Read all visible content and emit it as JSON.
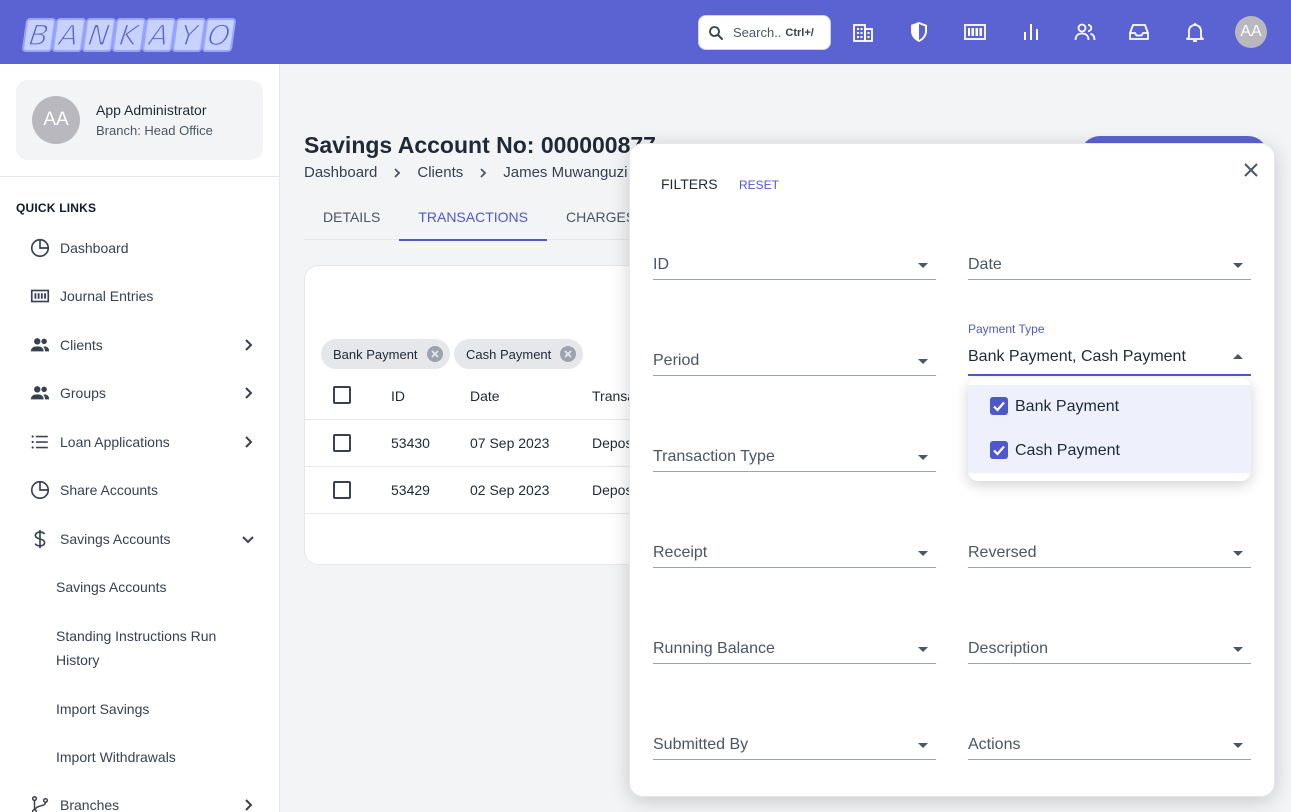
{
  "brand": {
    "logo_letters": [
      "B",
      "A",
      "N",
      "K",
      "A",
      "Y",
      "O"
    ],
    "accent": "#5b63d3"
  },
  "topbar": {
    "search_placeholder": "Search..",
    "search_shortcut": "Ctrl+/",
    "avatar_initials": "AA",
    "icons": [
      "building-icon",
      "shield-icon",
      "ledger-icon",
      "bar-chart-icon",
      "users-icon",
      "inbox-icon",
      "bell-icon"
    ]
  },
  "user": {
    "initials": "AA",
    "name": "App Administrator",
    "branch": "Branch: Head Office"
  },
  "sidebar": {
    "quick_links_title": "QUICK LINKS",
    "items": [
      {
        "label": "Dashboard"
      },
      {
        "label": "Journal Entries"
      },
      {
        "label": "Clients"
      },
      {
        "label": "Groups"
      },
      {
        "label": "Loan Applications"
      },
      {
        "label": "Share Accounts"
      },
      {
        "label": "Savings Accounts"
      },
      {
        "label": "Branches"
      }
    ],
    "sub_items": [
      {
        "label": "Savings Accounts"
      },
      {
        "label": "Standing Instructions Run History"
      },
      {
        "label": "Import Savings"
      },
      {
        "label": "Import Withdrawals"
      }
    ]
  },
  "page": {
    "title": "Savings Account No: 000000877",
    "breadcrumbs": [
      "Dashboard",
      "Clients",
      "James Muwanguzi"
    ],
    "tabs": [
      "DETAILS",
      "TRANSACTIONS",
      "CHARGES"
    ]
  },
  "table": {
    "chips": [
      "Bank Payment",
      "Cash Payment"
    ],
    "headers": [
      "ID",
      "Date",
      "Transaction Type"
    ],
    "rows": [
      {
        "id": "53430",
        "date": "07 Sep 2023",
        "type": "Deposit"
      },
      {
        "id": "53429",
        "date": "02 Sep 2023",
        "type": "Deposit"
      }
    ]
  },
  "filters": {
    "title": "FILTERS",
    "reset": "RESET",
    "fields_left": [
      "ID",
      "Period",
      "Transaction Type",
      "Receipt",
      "Running Balance",
      "Submitted By"
    ],
    "fields_right": [
      "Date",
      "Reversed",
      "Description",
      "Actions"
    ],
    "payment_type": {
      "label": "Payment Type",
      "value": "Bank Payment, Cash Payment",
      "options": [
        {
          "label": "Bank Payment",
          "checked": true
        },
        {
          "label": "Cash Payment",
          "checked": true
        }
      ]
    }
  }
}
